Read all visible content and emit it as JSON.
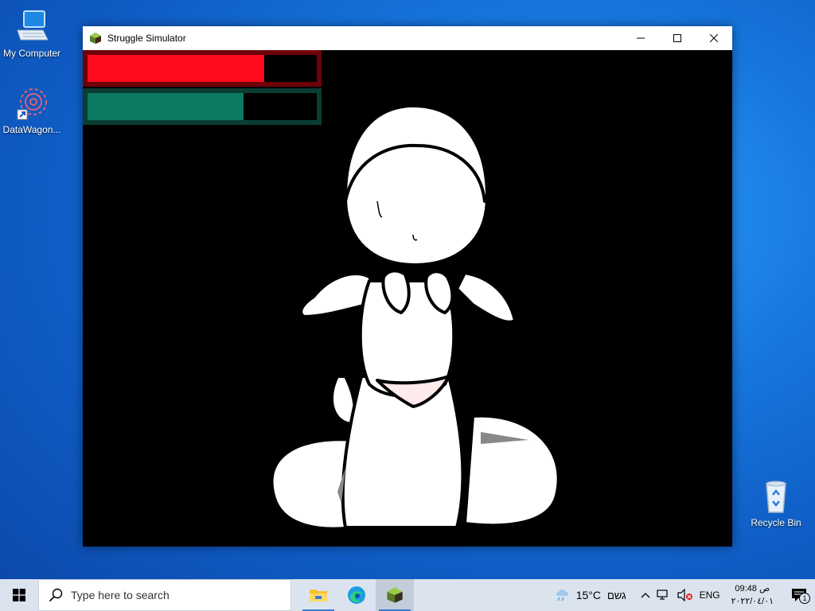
{
  "desktop": {
    "icons": [
      {
        "label": "My Computer"
      },
      {
        "label": "DataWagon..."
      },
      {
        "label": "Recycle Bin"
      }
    ]
  },
  "window": {
    "title": "Struggle Simulator",
    "health_bar": {
      "color": "#ff0a1f",
      "frame_color": "#6e0008",
      "level_percent": 77
    },
    "stamina_bar": {
      "color": "#0b7a62",
      "frame_color": "#0a3d33",
      "level_percent": 68
    }
  },
  "taskbar": {
    "search_placeholder": "Type here to search",
    "weather_temp": "15°C",
    "weather_text": "גשם",
    "language": "ENG",
    "clock_time": "09:48 ص",
    "clock_date": "٢٠٢٢/٠٤/٠١",
    "notification_count": "1",
    "accent_color": "#3a7bd5"
  }
}
